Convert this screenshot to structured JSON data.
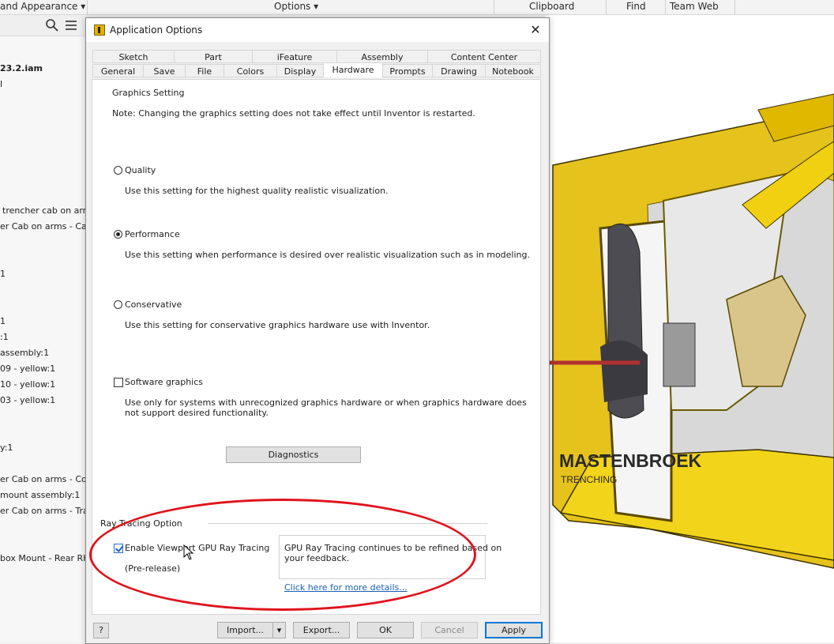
{
  "ribbon": {
    "left_label": "and Appearance",
    "options_label": "Options",
    "clipboard_label": "Clipboard",
    "find_label": "Find",
    "teamweb_label": "Team Web"
  },
  "browser": {
    "lines": [
      "23.2.iam",
      "l",
      "trencher cab on arms",
      "er Cab on arms - Cab S",
      "1",
      "1",
      ":1",
      "assembly:1",
      "09 - yellow:1",
      "10 - yellow:1",
      "03 - yellow:1",
      "y:1",
      "er Cab on arms - Contr",
      "mount assembly:1",
      "er Cab on arms - Track",
      "box Mount - Rear RH-:"
    ]
  },
  "viewport": {
    "brand_text": "MASTENBROEK",
    "sub_text": "TRENCHING"
  },
  "dialog": {
    "title": "Application Options",
    "tabs_top": [
      "Sketch",
      "Part",
      "iFeature",
      "Assembly",
      "Content Center"
    ],
    "tabs_bottom": [
      "General",
      "Save",
      "File",
      "Colors",
      "Display",
      "Hardware",
      "Prompts",
      "Drawing",
      "Notebook"
    ],
    "graphics_setting_label": "Graphics Setting",
    "note": "Note: Changing the graphics setting does not take effect until Inventor is restarted.",
    "quality": {
      "label": "Quality",
      "desc": "Use this setting for the highest quality realistic visualization."
    },
    "performance": {
      "label": "Performance",
      "desc": "Use this setting when performance is desired over realistic visualization such as in modeling."
    },
    "conservative": {
      "label": "Conservative",
      "desc": "Use this setting for conservative graphics hardware use with Inventor."
    },
    "software": {
      "label": "Software graphics",
      "desc1": "Use only for systems with unrecognized graphics hardware or when graphics hardware does",
      "desc2": "not support desired functionality."
    },
    "diagnostics_label": "Diagnostics",
    "ray_tracing_label": "Ray Tracing Option",
    "enable_rt_label": "Enable Viewport GPU Ray Tracing",
    "prerelease_label": "(Pre-release)",
    "info_text1": "GPU Ray Tracing continues to be refined based on",
    "info_text2": "your feedback.",
    "link_text": "Click here for more details...",
    "buttons": {
      "help": "?",
      "import": "Import...",
      "export": "Export...",
      "ok": "OK",
      "cancel": "Cancel",
      "apply": "Apply"
    }
  }
}
